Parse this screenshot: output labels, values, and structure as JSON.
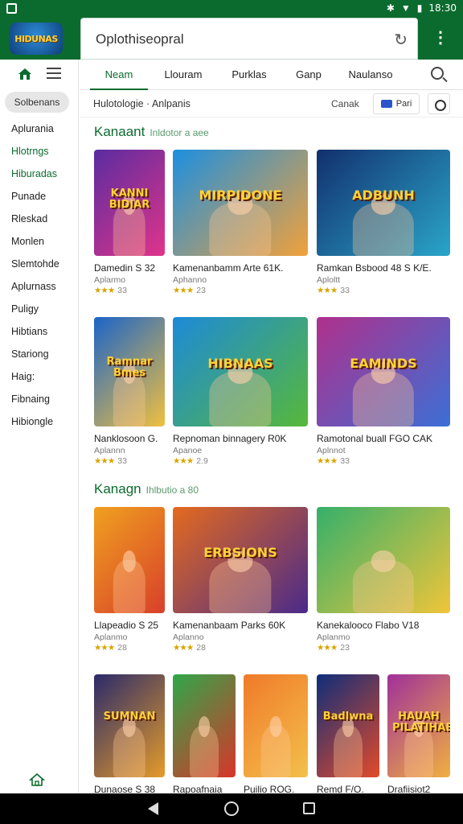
{
  "status": {
    "time": "18:30"
  },
  "header": {
    "logo_text": "HIDUNAS",
    "search_value": "Oplothiseopral"
  },
  "sidebar": {
    "chip": "Solbenans",
    "items": [
      {
        "label": "Aplurania",
        "green": false
      },
      {
        "label": "Hlotrngs",
        "green": true
      },
      {
        "label": "Hiburadas",
        "green": true
      },
      {
        "label": "Punade",
        "green": false
      },
      {
        "label": "Rleskad",
        "green": false
      },
      {
        "label": "Monlen",
        "green": false
      },
      {
        "label": "Slemtohde",
        "green": false
      },
      {
        "label": "Aplurnass",
        "green": false
      },
      {
        "label": "Puligy",
        "green": false
      },
      {
        "label": "Hibtians",
        "green": false
      },
      {
        "label": "Stariong",
        "green": false
      },
      {
        "label": "Haig:",
        "green": false
      },
      {
        "label": "Fibnaing",
        "green": false
      },
      {
        "label": "Hibiongle",
        "green": false
      }
    ]
  },
  "tabs": [
    "Neam",
    "Llouram",
    "Purklas",
    "Ganp",
    "Naulanso"
  ],
  "filter": {
    "label": "Hulotologie · Anlpanis",
    "cancel": "Canak",
    "button": "Pari"
  },
  "sections": [
    {
      "title": "Kanaant",
      "sub": "Inldotor a aee"
    },
    {
      "title": "Kanagn",
      "sub": "Ihlbutio a 80"
    }
  ],
  "cards": [
    {
      "title": "Damedin S 32",
      "sub": "Aplarmo",
      "stars": "★★★",
      "rating": "33",
      "thumb": "KANNI BIDIAR",
      "colors": [
        "#5a2ca0",
        "#e0348a"
      ]
    },
    {
      "title": "Kamenanbamm Arte 61K.",
      "sub": "Aphanno",
      "stars": "★★★",
      "rating": "23",
      "thumb": "MIRPIDONE",
      "colors": [
        "#1c8fe0",
        "#f2a13a"
      ]
    },
    {
      "title": "Ramkan Bsbood 48 S K/E.",
      "sub": "Aploltt",
      "stars": "★★★",
      "rating": "33",
      "thumb": "ADBUNH",
      "colors": [
        "#12306e",
        "#2aa5c9"
      ]
    },
    {
      "title": "Nanklosoon G.",
      "sub": "Aplannn",
      "stars": "★★★",
      "rating": "33",
      "thumb": "Ramnar Bmes",
      "colors": [
        "#1b64c8",
        "#f0c040"
      ]
    },
    {
      "title": "Repnoman binnagery R0K",
      "sub": "Apanoe",
      "stars": "★★★",
      "rating": "2.9",
      "thumb": "HIBNAAS",
      "colors": [
        "#1d8ad8",
        "#57b83a"
      ]
    },
    {
      "title": "Ramotonal buall FGO CAK",
      "sub": "Aplnnot",
      "stars": "★★★",
      "rating": "33",
      "thumb": "EAMINDS",
      "colors": [
        "#b0308c",
        "#3b6fd6"
      ]
    },
    {
      "title": "Llapeadio S 25",
      "sub": "Aplanmo",
      "stars": "★★★",
      "rating": "28",
      "thumb": "",
      "colors": [
        "#f0a020",
        "#d8402a"
      ]
    },
    {
      "title": "Kamenanbaam Parks 60K",
      "sub": "Aplanno",
      "stars": "★★★",
      "rating": "28",
      "thumb": "ERBSIONS",
      "colors": [
        "#e46a1f",
        "#4a2a8a"
      ]
    },
    {
      "title": "Kanekalooco Flabo V18",
      "sub": "Aplanmo",
      "stars": "★★★",
      "rating": "23",
      "thumb": "",
      "colors": [
        "#35b06a",
        "#f0c53a"
      ]
    },
    {
      "title": "Dunaose S 38",
      "sub": "",
      "stars": "",
      "rating": "",
      "thumb": "SUMNAN",
      "colors": [
        "#2a2a6a",
        "#e59b2a"
      ]
    },
    {
      "title": "Rapoafnaia",
      "sub": "",
      "stars": "",
      "rating": "",
      "thumb": "",
      "colors": [
        "#2ea84a",
        "#d8342a"
      ]
    },
    {
      "title": "Puilio ROG.",
      "sub": "",
      "stars": "",
      "rating": "",
      "thumb": "",
      "colors": [
        "#f07a2a",
        "#f3c04a"
      ]
    },
    {
      "title": "Remd F/O.",
      "sub": "",
      "stars": "",
      "rating": "",
      "thumb": "Badlwna",
      "colors": [
        "#0e2e7a",
        "#e34a2a"
      ]
    },
    {
      "title": "Drafiisiot2",
      "sub": "",
      "stars": "",
      "rating": "",
      "thumb": "HAUAH PILATIHAB",
      "colors": [
        "#a0309a",
        "#f0b040"
      ]
    }
  ]
}
